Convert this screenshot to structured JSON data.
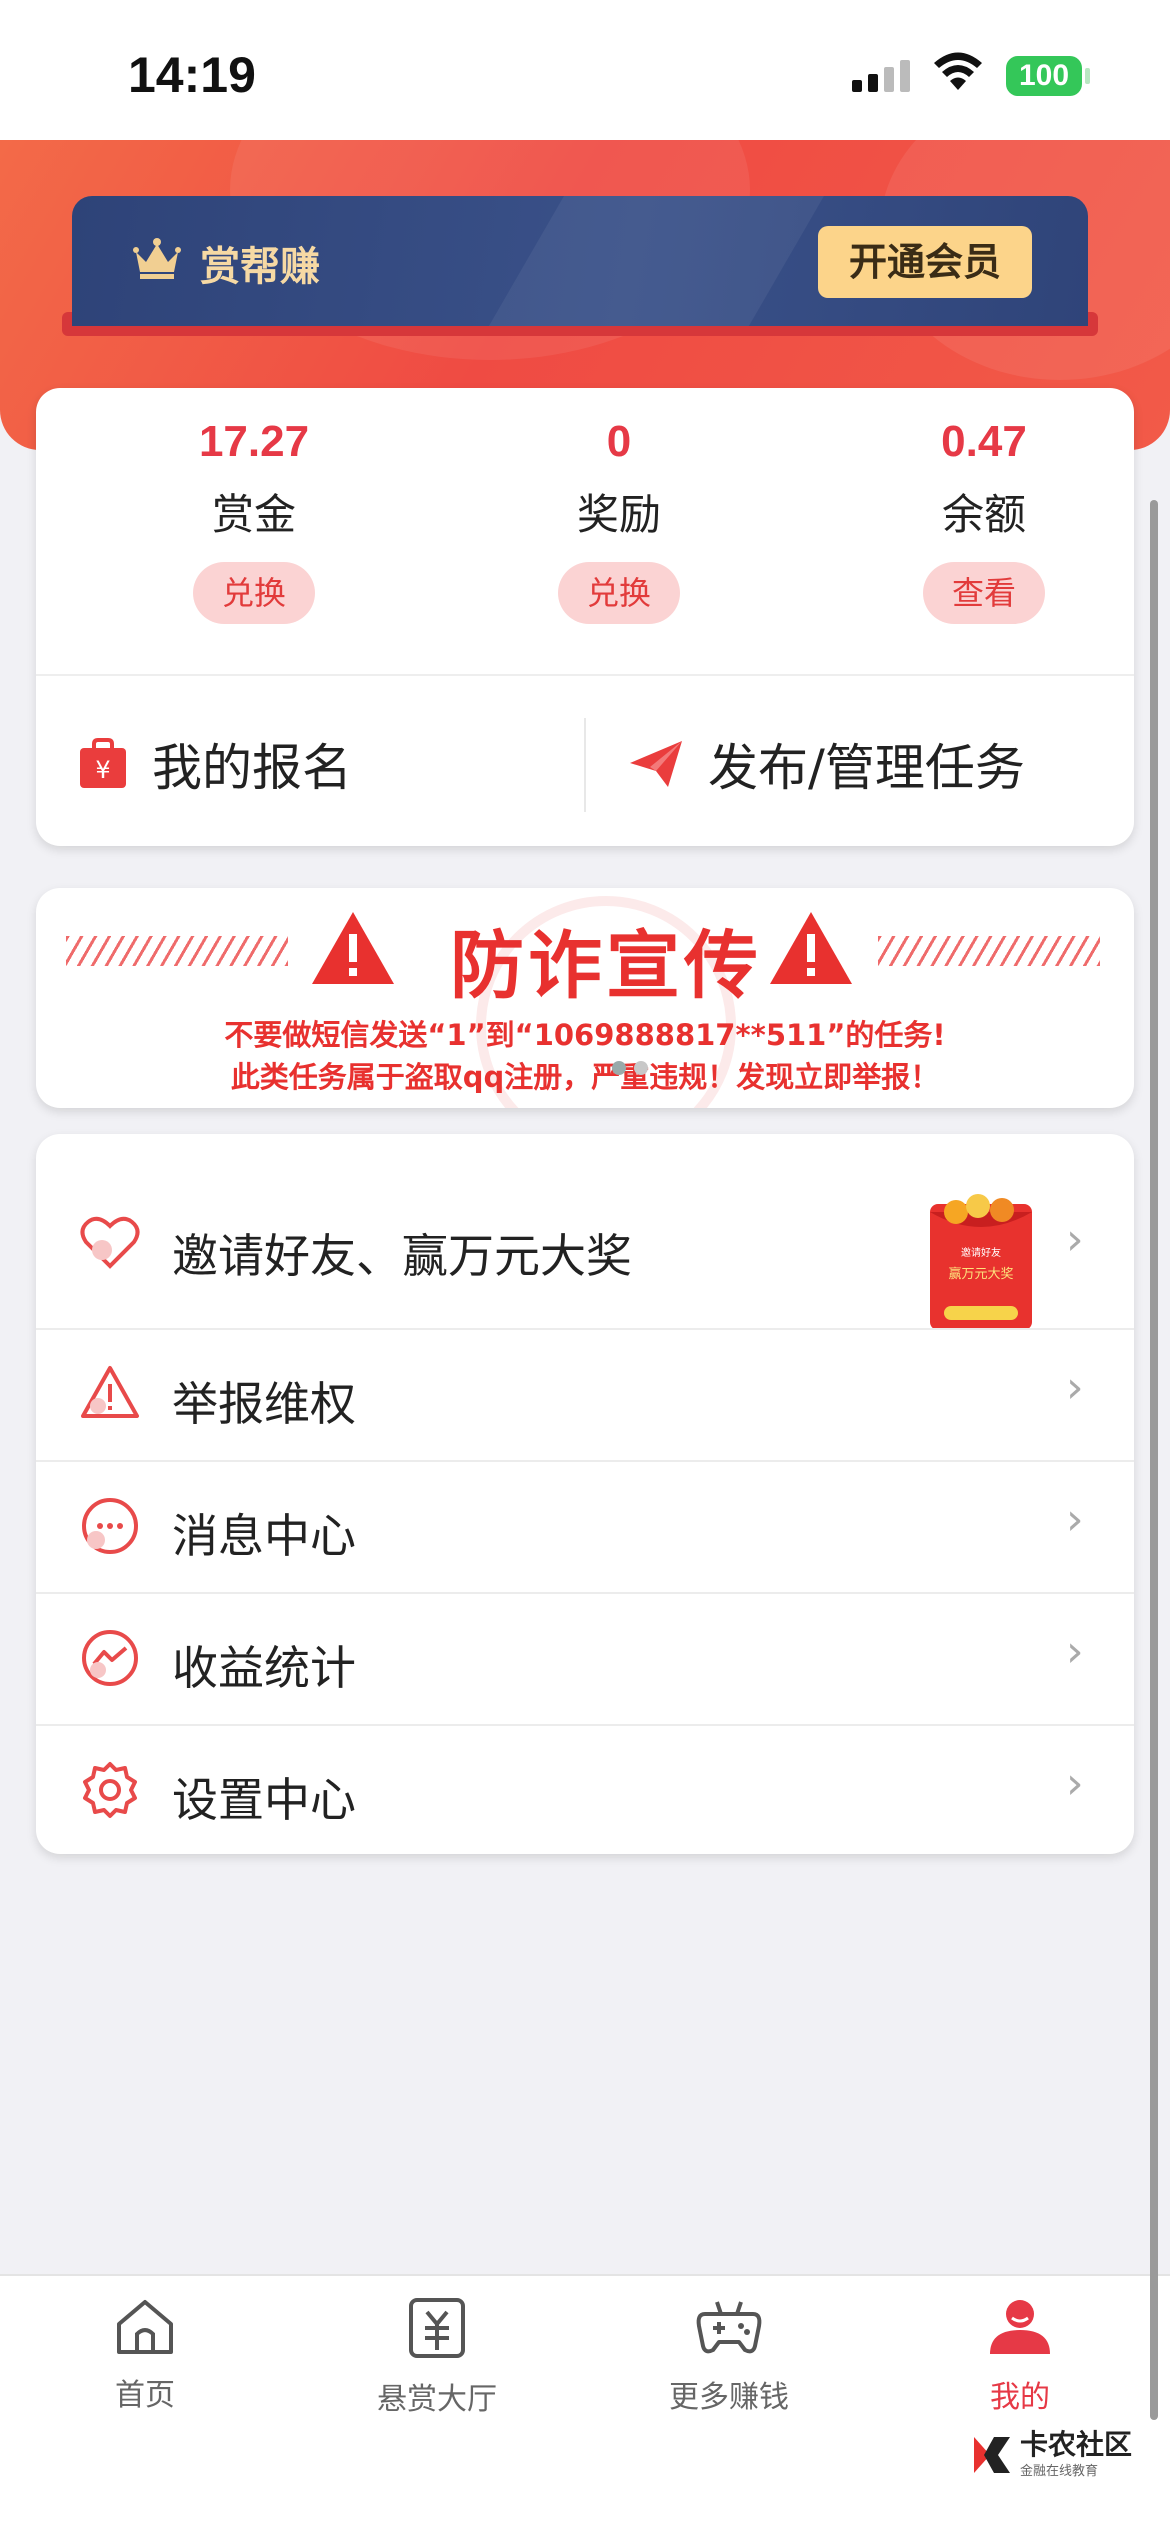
{
  "status": {
    "time": "14:19",
    "battery": "100"
  },
  "vip": {
    "title": "赏帮赚",
    "button": "开通会员"
  },
  "stats": [
    {
      "value": "17.27",
      "label": "赏金",
      "action": "兑换"
    },
    {
      "value": "0",
      "label": "奖励",
      "action": "兑换"
    },
    {
      "value": "0.47",
      "label": "余额",
      "action": "查看"
    }
  ],
  "actions": {
    "signup": "我的报名",
    "publish": "发布/管理任务"
  },
  "fraud": {
    "title": "防诈宣传",
    "line1": "不要做短信发送“1”到“1069888817**511”的任务!",
    "line2": "此类任务属于盗取qq注册，严重违规！发现立即举报！"
  },
  "menu": [
    {
      "label": "邀请好友、赢万元大奖",
      "icon": "heart-icon"
    },
    {
      "label": "举报维权",
      "icon": "warning-icon"
    },
    {
      "label": "消息中心",
      "icon": "chat-icon"
    },
    {
      "label": "收益统计",
      "icon": "chart-icon"
    },
    {
      "label": "设置中心",
      "icon": "gear-icon"
    }
  ],
  "redpack": {
    "top": "邀请好友",
    "main": "赢万元大奖"
  },
  "tabs": [
    {
      "label": "首页",
      "icon": "home-icon"
    },
    {
      "label": "悬赏大厅",
      "icon": "yuan-icon"
    },
    {
      "label": "更多赚钱",
      "icon": "gamepad-icon"
    },
    {
      "label": "我的",
      "icon": "user-icon"
    }
  ],
  "watermark": {
    "title": "卡农社区",
    "subtitle": "金融在线教育"
  },
  "colors": {
    "accent": "#e63946",
    "vip_bg": "#2e4378",
    "vip_gold": "#fcd48a"
  }
}
